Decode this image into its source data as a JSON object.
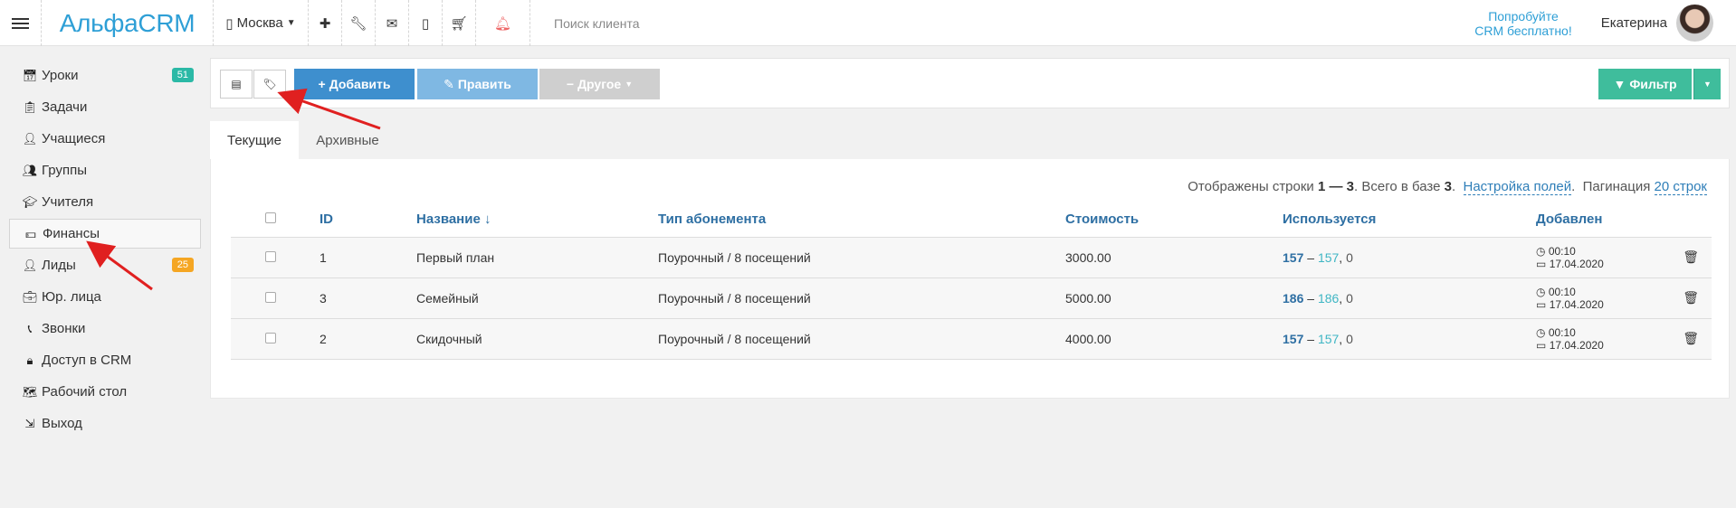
{
  "topbar": {
    "logo": "АльфаCRM",
    "city": "Москва",
    "search_placeholder": "Поиск клиента",
    "try_line1": "Попробуйте",
    "try_line2": "CRM бесплатно!",
    "user_name": "Екатерина"
  },
  "sidebar": {
    "items": [
      {
        "label": "Уроки",
        "badge": "51"
      },
      {
        "label": "Задачи"
      },
      {
        "label": "Учащиеся"
      },
      {
        "label": "Группы"
      },
      {
        "label": "Учителя"
      },
      {
        "label": "Финансы"
      },
      {
        "label": "Лиды",
        "badge": "25"
      },
      {
        "label": "Юр. лица"
      },
      {
        "label": "Звонки"
      },
      {
        "label": "Доступ в CRM"
      },
      {
        "label": "Рабочий стол"
      },
      {
        "label": "Выход"
      }
    ]
  },
  "toolbar": {
    "add_label": "Добавить",
    "edit_label": "Править",
    "other_label": "Другое",
    "filter_label": "Фильтр"
  },
  "tabs": {
    "current": "Текущие",
    "archived": "Архивные"
  },
  "info": {
    "prefix": "Отображены строки",
    "range": "1 — 3",
    "total_text": ". Всего в базе",
    "total": "3",
    "fields_link": "Настройка полей",
    "pagination_label": "Пагинация",
    "pagination_value": "20 строк"
  },
  "table": {
    "headers": {
      "id": "ID",
      "name": "Название ↓",
      "type": "Тип абонемента",
      "cost": "Стоимость",
      "used": "Используется",
      "added": "Добавлен"
    },
    "rows": [
      {
        "id": "1",
        "name": "Первый план",
        "type": "Поурочный / 8 посещений",
        "cost": "3000.00",
        "used_a": "157",
        "used_b": "157",
        "used_c": "0",
        "time": "00:10",
        "date": "17.04.2020"
      },
      {
        "id": "3",
        "name": "Семейный",
        "type": "Поурочный / 8 посещений",
        "cost": "5000.00",
        "used_a": "186",
        "used_b": "186",
        "used_c": "0",
        "time": "00:10",
        "date": "17.04.2020"
      },
      {
        "id": "2",
        "name": "Скидочный",
        "type": "Поурочный / 8 посещений",
        "cost": "4000.00",
        "used_a": "157",
        "used_b": "157",
        "used_c": "0",
        "time": "00:10",
        "date": "17.04.2020"
      }
    ]
  }
}
